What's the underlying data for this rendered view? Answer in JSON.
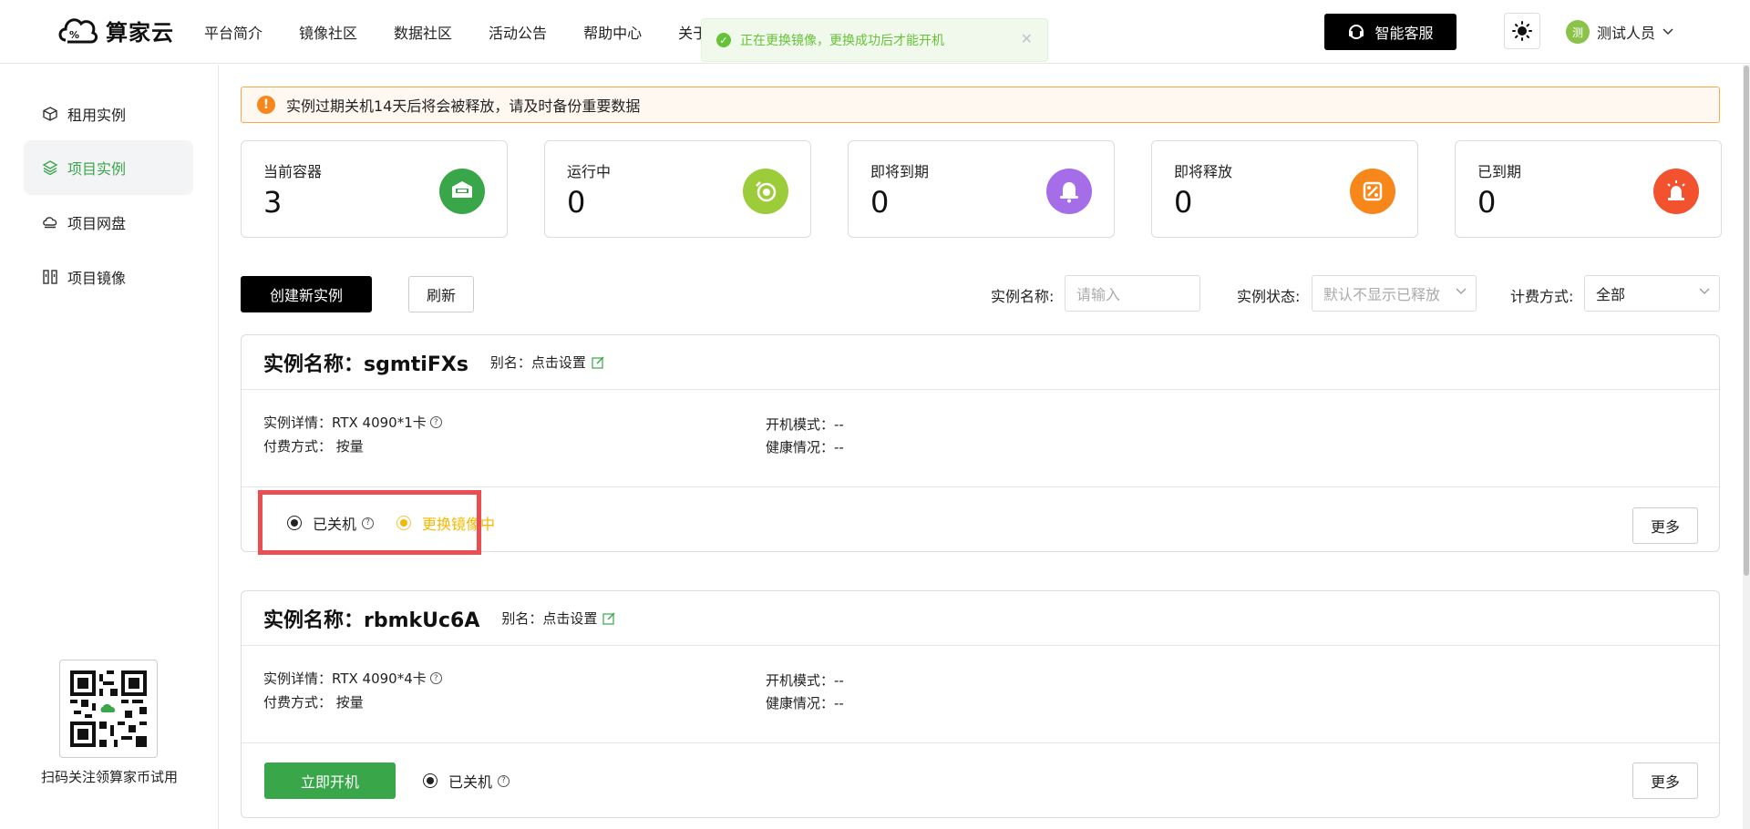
{
  "header": {
    "logo_text": "算家云",
    "nav": [
      "平台简介",
      "镜像社区",
      "数据社区",
      "活动公告",
      "帮助中心",
      "关于"
    ],
    "service_label": "智能客服",
    "user_avatar": "测",
    "user_name": "测试人员"
  },
  "toast": {
    "message": "正在更换镜像，更换成功后才能开机"
  },
  "sidebar": {
    "items": [
      {
        "label": "租用实例",
        "icon": "cube-icon"
      },
      {
        "label": "项目实例",
        "icon": "layers-icon"
      },
      {
        "label": "项目网盘",
        "icon": "cloud-drive-icon"
      },
      {
        "label": "项目镜像",
        "icon": "mirror-icon"
      }
    ],
    "active_index": 1,
    "qr_caption": "扫码关注领算家币试用"
  },
  "notice": {
    "text": "实例过期关机14天后将会被释放，请及时备份重要数据"
  },
  "stats": [
    {
      "label": "当前容器",
      "value": "3",
      "color": "#3aa64a"
    },
    {
      "label": "运行中",
      "value": "0",
      "color": "#9ccc3a"
    },
    {
      "label": "即将到期",
      "value": "0",
      "color": "#a56ee8"
    },
    {
      "label": "即将释放",
      "value": "0",
      "color": "#f7871b"
    },
    {
      "label": "已到期",
      "value": "0",
      "color": "#f2522e"
    }
  ],
  "toolbar": {
    "create_label": "创建新实例",
    "refresh_label": "刷新",
    "name_label": "实例名称:",
    "name_placeholder": "请输入",
    "status_label": "实例状态:",
    "status_placeholder": "默认不显示已释放",
    "billing_label": "计费方式:",
    "billing_value": "全部"
  },
  "instances": [
    {
      "title": "实例名称：sgmtiFXs",
      "alias": "别名：点击设置",
      "detail": "实例详情：RTX 4090*1卡",
      "payment": "付费方式：  按量",
      "boot_mode": "开机模式：--",
      "health": "健康情况：--",
      "status": "已关机",
      "status2": "更换镜像中",
      "more_label": "更多"
    },
    {
      "title": "实例名称：rbmkUc6A",
      "alias": "别名：点击设置",
      "detail": "实例详情：RTX 4090*4卡",
      "payment": "付费方式：  按量",
      "boot_mode": "开机模式：--",
      "health": "健康情况：--",
      "start_label": "立即开机",
      "status": "已关机",
      "more_label": "更多"
    }
  ]
}
